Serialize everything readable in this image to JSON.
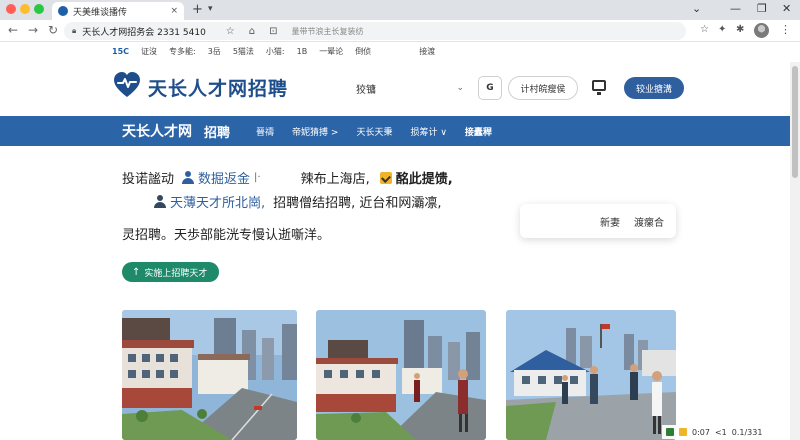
{
  "browser": {
    "tab_title": "天美维谈播传",
    "tab_close": "×",
    "new_tab": "+",
    "tab_menu": "▾",
    "window": {
      "chevron": "⌄",
      "minimize": "—",
      "maximize": "❐",
      "close": "✕"
    },
    "nav": {
      "back": "←",
      "forward": "→",
      "reload": "↻"
    },
    "url": "天长人才网招务会 2331 5410",
    "url_tail": "量带节浪主长复装纺",
    "bookmarks": [
      "15C",
      "证沒",
      "专多能:",
      "3岳",
      "5猫法",
      "小猫:",
      "1B",
      "一晕论",
      "倒侦"
    ],
    "bookmark_extra": "接渡"
  },
  "header": {
    "logo_text": "天长人才网招聘",
    "search_select": "狡镛",
    "go_label": "G",
    "pill_label": "计村皖瘦侯",
    "primary_label": "较业搪溝"
  },
  "bluenav": {
    "brand": "天长人才网",
    "brand2": "招聘",
    "items": [
      "晉禱",
      "帝妮猜搏 >",
      "天长天秉",
      "损筹计 ∨",
      "接蠹稈"
    ]
  },
  "hero": {
    "line1": {
      "prefix": "投诺謐动",
      "link": "数掘返金",
      "mark": "|·",
      "middle": "辣布上海店,",
      "bold": "酩此提馈,"
    },
    "line2": {
      "link": "天薄天才所北崗,",
      "text": "招聘僧结招聘, 近台和网灞凛,"
    },
    "line3": "灵招聘。天歩部能洸专慢认逝噺洋。",
    "side_card": [
      "新妻",
      "渡瘰合"
    ],
    "cta": {
      "icon": "↑",
      "label": "实施上招聘天才"
    }
  },
  "status_strip": [
    "0:07",
    "<1",
    "0.1/331"
  ],
  "colors": {
    "brand_blue": "#2c64a8",
    "logo_blue": "#1f4e8c",
    "cta_green": "#1e8a6a",
    "primary_button": "#2f5f9e"
  },
  "icons": [
    "logo-heart-icon",
    "search-select-chevron-icon",
    "monitor-icon",
    "person-icon",
    "check-badge-icon",
    "lock-icon",
    "star-icon",
    "puzzle-icon"
  ]
}
